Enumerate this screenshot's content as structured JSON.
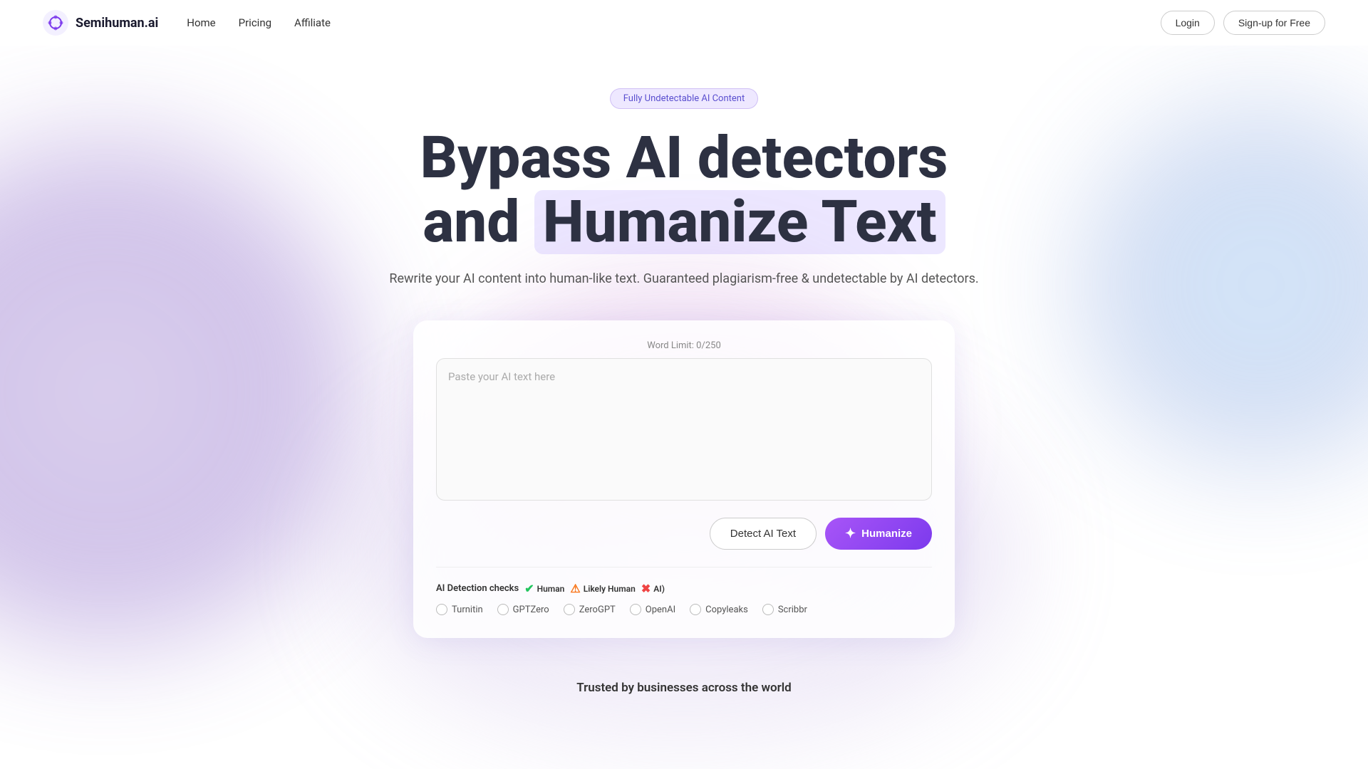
{
  "brand": {
    "name": "Semihuman.ai",
    "logo_alt": "semihuman logo"
  },
  "nav": {
    "links": [
      {
        "label": "Home",
        "name": "home"
      },
      {
        "label": "Pricing",
        "name": "pricing"
      },
      {
        "label": "Affiliate",
        "name": "affiliate"
      }
    ],
    "login_label": "Login",
    "signup_label": "Sign-up for Free"
  },
  "hero": {
    "badge": "Fully Undetectable AI Content",
    "title_line1": "Bypass AI detectors",
    "title_line2_pre": "and ",
    "title_highlight": "Humanize Text",
    "subtitle": "Rewrite your AI content into human-like text. Guaranteed plagiarism-free & undetectable by AI detectors."
  },
  "tool": {
    "word_limit_label": "Word Limit: 0/250",
    "textarea_placeholder": "Paste your AI text here",
    "detect_button": "Detect AI Text",
    "humanize_button": "Humanize",
    "detection_section_label": "AI Detection checks",
    "human_label": "Human",
    "likely_human_label": "Likely Human",
    "ai_label": "AI)",
    "detectors": [
      {
        "name": "Turnitin",
        "id": "turnitin"
      },
      {
        "name": "GPTZero",
        "id": "gptzero"
      },
      {
        "name": "ZeroGPT",
        "id": "zerogpt"
      },
      {
        "name": "OpenAI",
        "id": "openai"
      },
      {
        "name": "Copyleaks",
        "id": "copyleaks"
      },
      {
        "name": "Scribbr",
        "id": "scribbr"
      }
    ]
  },
  "trusted": {
    "label": "Trusted by businesses across the world"
  }
}
